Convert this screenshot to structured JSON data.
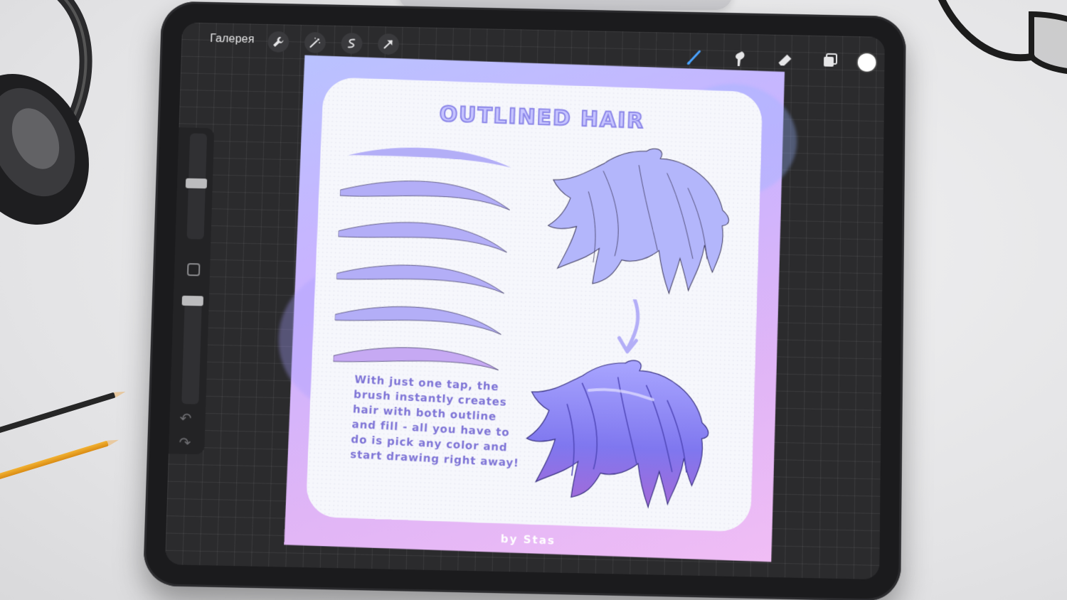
{
  "topbar": {
    "gallery_label": "Галерея",
    "left_tools": [
      "wrench-icon",
      "magic-wand-icon",
      "selection-icon",
      "transform-arrow-icon"
    ],
    "right_tools": [
      "brush-icon",
      "smudge-icon",
      "eraser-icon",
      "layers-icon"
    ],
    "active_tool": "brush-icon",
    "active_color": "#ffffff",
    "accent_color": "#4aa3ff"
  },
  "sidebar": {
    "undo_icon": "↶",
    "redo_icon": "↷"
  },
  "artwork": {
    "title": "OUTLINED HAIR",
    "description": "With just one tap, the brush instantly creates hair with both outline and fill - all you have to do is pick any color and start drawing right away!",
    "byline": "by Stas",
    "hair_color": "#8f8af0",
    "stroke_color": "#b3aef7"
  }
}
